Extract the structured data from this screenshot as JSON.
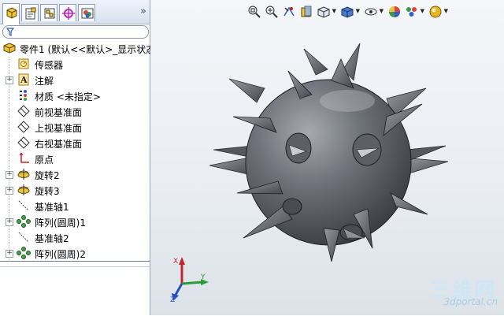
{
  "panel": {
    "tabs": [
      {
        "name": "featuremanager-tab",
        "icon": "featuremanager-icon",
        "active": true
      },
      {
        "name": "propertymanager-tab",
        "icon": "propertymanager-icon",
        "active": false
      },
      {
        "name": "configurationmanager-tab",
        "icon": "configurationmanager-icon",
        "active": false
      },
      {
        "name": "dimxpertmanager-tab",
        "icon": "dimxpert-icon",
        "active": false
      },
      {
        "name": "displaymanager-tab",
        "icon": "displaymanager-icon",
        "active": false
      }
    ],
    "tabs_more": "»",
    "filter_icon": "filter-icon"
  },
  "tree": {
    "root": "零件1  (默认<<默认>_显示状态",
    "items": [
      {
        "label": "传感器",
        "icon": "sensor-icon",
        "expandable": false
      },
      {
        "label": "注解",
        "icon": "annotation-icon",
        "expandable": true
      },
      {
        "label": "材质 <未指定>",
        "icon": "material-icon",
        "expandable": false
      },
      {
        "label": "前视基准面",
        "icon": "plane-icon",
        "expandable": false
      },
      {
        "label": "上视基准面",
        "icon": "plane-icon",
        "expandable": false
      },
      {
        "label": "右视基准面",
        "icon": "plane-icon",
        "expandable": false
      },
      {
        "label": "原点",
        "icon": "origin-icon",
        "expandable": false
      },
      {
        "label": "旋转2",
        "icon": "revolve-icon",
        "expandable": true
      },
      {
        "label": "旋转3",
        "icon": "revolve-icon",
        "expandable": true
      },
      {
        "label": "基准轴1",
        "icon": "axis-icon",
        "expandable": false
      },
      {
        "label": "阵列(圆周)1",
        "icon": "circular-pattern-icon",
        "expandable": true
      },
      {
        "label": "基准轴2",
        "icon": "axis-icon",
        "expandable": false
      },
      {
        "label": "阵列(圆周)2",
        "icon": "circular-pattern-icon",
        "expandable": true
      }
    ]
  },
  "viewport": {
    "toolbar": [
      {
        "name": "zoom-to-fit",
        "icon": "zoom-fit-icon"
      },
      {
        "name": "zoom-to-area",
        "icon": "zoom-area-icon"
      },
      {
        "name": "previous-view",
        "icon": "previous-view-icon"
      },
      {
        "name": "section-view",
        "icon": "section-view-icon"
      },
      {
        "name": "view-orientation",
        "icon": "view-orientation-icon",
        "dropdown": true
      },
      {
        "name": "display-style",
        "icon": "display-style-icon",
        "dropdown": true
      },
      {
        "name": "hide-show-items",
        "icon": "hide-show-icon",
        "dropdown": true
      },
      {
        "name": "edit-appearance",
        "icon": "appearance-icon"
      },
      {
        "name": "apply-scene",
        "icon": "scene-icon",
        "dropdown": true
      },
      {
        "name": "view-settings",
        "icon": "view-settings-icon",
        "dropdown": true
      }
    ],
    "triad": {
      "x": "X",
      "y": "Y",
      "z": "Z"
    },
    "watermark": {
      "cn": "三维网",
      "url": "3dportal.cn"
    }
  },
  "colors": {
    "model_gray": "#6e7179",
    "model_dark": "#3a3c42",
    "panel_border": "#9aa5b5",
    "triad_x": "#c0282d",
    "triad_y": "#2a9a3a",
    "triad_z": "#2b4fc0"
  }
}
